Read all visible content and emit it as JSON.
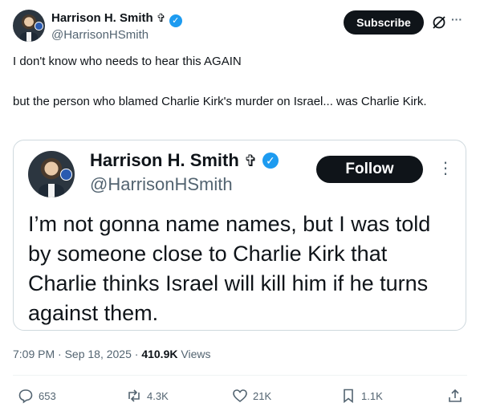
{
  "tweet": {
    "author_name": "Harrison H. Smith",
    "cross_glyph": "✞",
    "handle": "@HarrisonHSmith",
    "subscribe_label": "Subscribe",
    "more_glyph": "···",
    "text_line1": "I don't know who needs to hear this AGAIN",
    "text_line2": "but the person who blamed Charlie Kirk's murder on Israel... was Charlie Kirk.",
    "timestamp": "7:09 PM · Sep 18, 2025 · ",
    "views_count": "410.9K",
    "views_label": " Views"
  },
  "quoted": {
    "author_name": "Harrison H. Smith",
    "cross_glyph": "✞",
    "handle": "@HarrisonHSmith",
    "follow_label": "Follow",
    "more_glyph": "⋮",
    "text": "I’m not gonna name names, but I was told by someone close to Charlie Kirk that Charlie thinks Israel will kill him if he turns against them."
  },
  "actions": {
    "replies": "653",
    "reposts": "4.3K",
    "likes": "21K",
    "bookmarks": "1.1K"
  },
  "colors": {
    "verified": "#1d9bf0",
    "text": "#0f1419",
    "secondary": "#536471",
    "button": "#0f1419"
  },
  "icons": [
    "verified-icon",
    "grok-icon",
    "more-icon",
    "reply-icon",
    "repost-icon",
    "like-icon",
    "bookmark-icon",
    "share-icon"
  ]
}
